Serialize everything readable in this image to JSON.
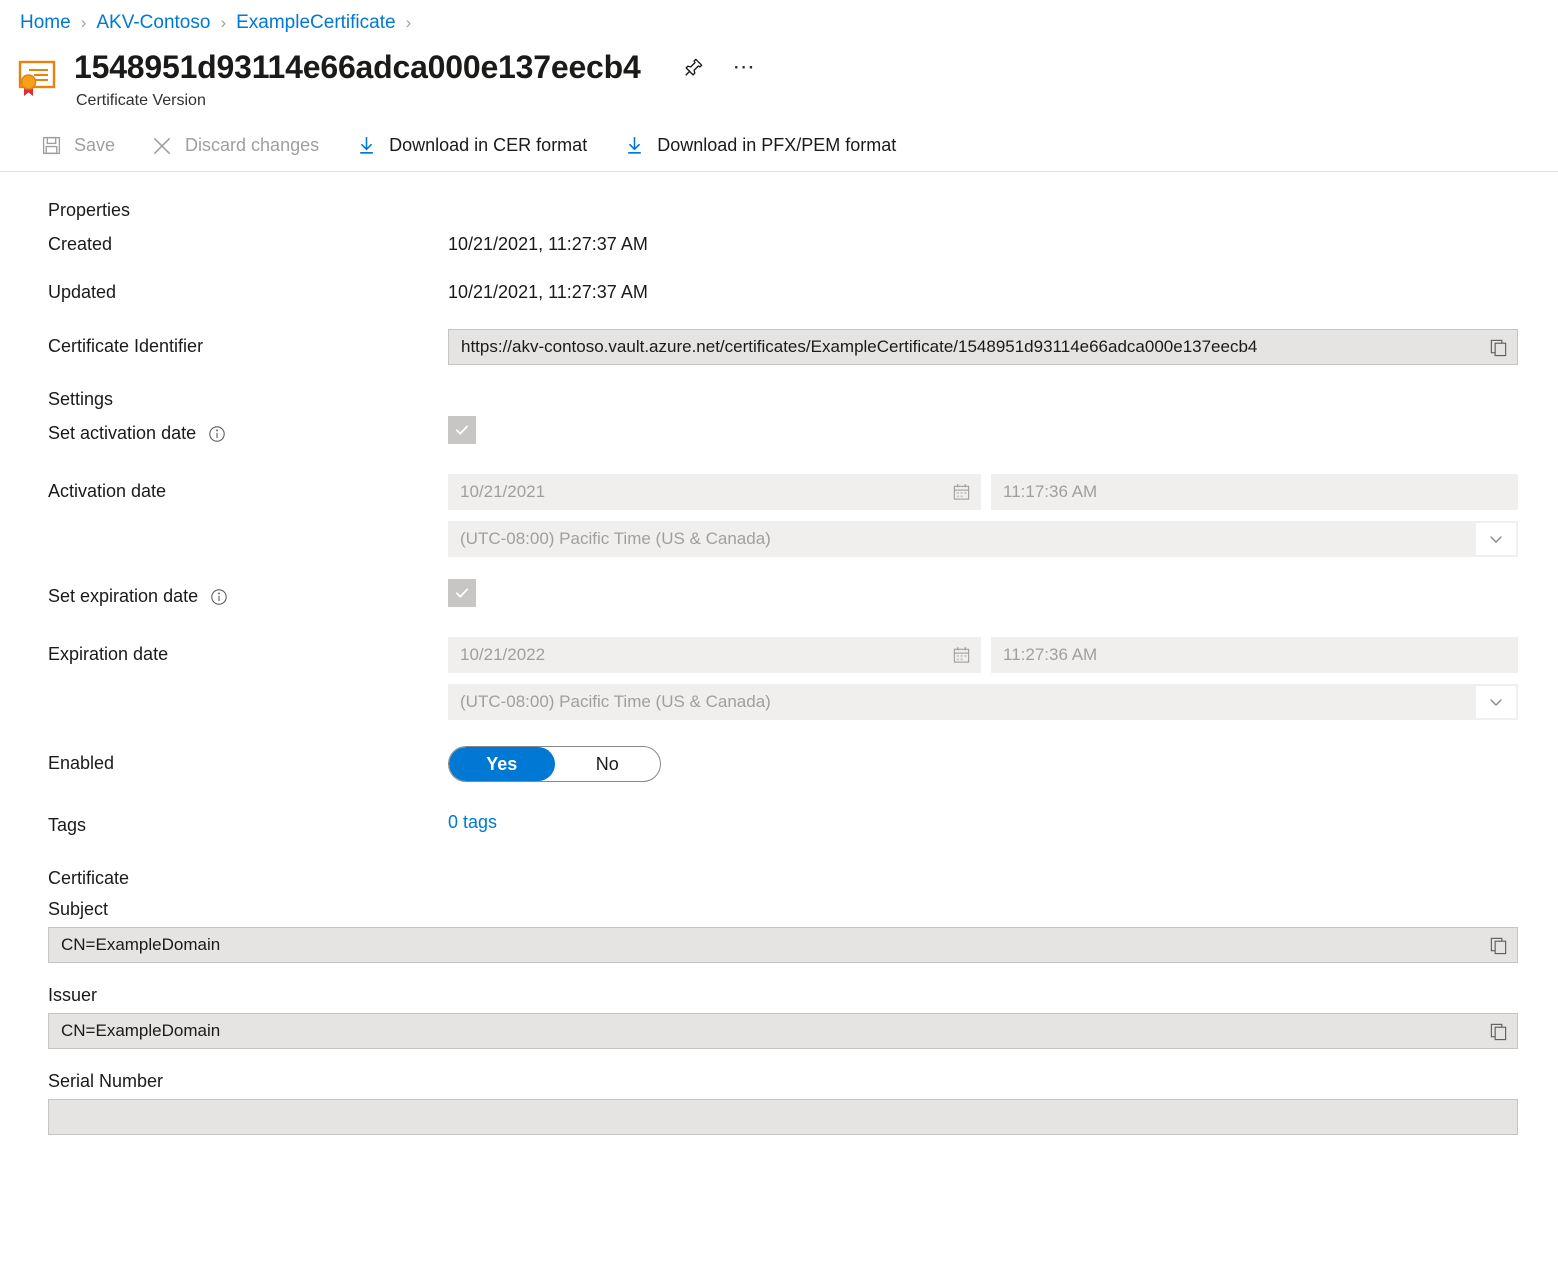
{
  "breadcrumb": {
    "items": [
      {
        "label": "Home"
      },
      {
        "label": "AKV-Contoso"
      },
      {
        "label": "ExampleCertificate"
      }
    ],
    "separator": "›"
  },
  "header": {
    "icon": "certificate-icon",
    "title": "1548951d93114e66adca000e137eecb4",
    "subtitle": "Certificate Version",
    "pin_icon": "pin-icon",
    "more_icon": "ellipsis-icon"
  },
  "commandbar": {
    "items": [
      {
        "label": "Save",
        "icon": "save-icon",
        "enabled": false
      },
      {
        "label": "Discard changes",
        "icon": "close-x-icon",
        "enabled": false
      },
      {
        "label": "Download in CER format",
        "icon": "download-icon",
        "enabled": true
      },
      {
        "label": "Download in PFX/PEM format",
        "icon": "download-icon",
        "enabled": true
      }
    ]
  },
  "properties": {
    "heading": "Properties",
    "created_label": "Created",
    "created_value": "10/21/2021, 11:27:37 AM",
    "updated_label": "Updated",
    "updated_value": "10/21/2021, 11:27:37 AM",
    "identifier_label": "Certificate Identifier",
    "identifier_value": "https://akv-contoso.vault.azure.net/certificates/ExampleCertificate/1548951d93114e66adca000e137eecb4"
  },
  "settings": {
    "heading": "Settings",
    "set_activation_label": "Set activation date",
    "set_activation_checked": true,
    "activation_label": "Activation date",
    "activation_date": "10/21/2021",
    "activation_time": "11:17:36 AM",
    "activation_timezone": "(UTC-08:00) Pacific Time (US & Canada)",
    "set_expiration_label": "Set expiration date",
    "set_expiration_checked": true,
    "expiration_label": "Expiration date",
    "expiration_date": "10/21/2022",
    "expiration_time": "11:27:36 AM",
    "expiration_timezone": "(UTC-08:00) Pacific Time (US & Canada)",
    "enabled_label": "Enabled",
    "enabled_yes": "Yes",
    "enabled_no": "No",
    "enabled_value": "Yes",
    "tags_label": "Tags",
    "tags_value": "0 tags"
  },
  "certificate": {
    "heading": "Certificate",
    "subject_label": "Subject",
    "subject_value": "CN=ExampleDomain",
    "issuer_label": "Issuer",
    "issuer_value": "CN=ExampleDomain",
    "serial_label": "Serial Number"
  },
  "colors": {
    "accent": "#0078d4",
    "link": "#0078d4",
    "text": "#1b1a19",
    "disabled_text": "#a19f9d",
    "field_bg": "#e5e4e2",
    "field_disabled_bg": "#f0efee",
    "checkbox_bg": "#c8c6c4",
    "cert_icon_orange": "#e8820c",
    "cert_icon_red": "#d13438"
  }
}
